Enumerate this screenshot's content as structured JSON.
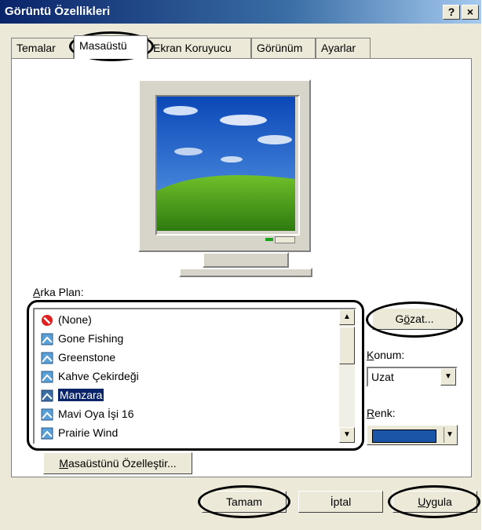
{
  "window": {
    "title": "Görüntü Özellikleri",
    "help_label": "?",
    "close_label": "×"
  },
  "tabs": [
    {
      "label": "Temalar",
      "active": false
    },
    {
      "label": "Masaüstü",
      "active": true
    },
    {
      "label": "Ekran Koruyucu",
      "active": false
    },
    {
      "label": "Görünüm",
      "active": false
    },
    {
      "label": "Ayarlar",
      "active": false
    }
  ],
  "background": {
    "label_prefix": "A",
    "label_rest": "rka Plan:",
    "items": [
      {
        "label": "(None)",
        "icon": "none-icon",
        "selected": false
      },
      {
        "label": "Gone Fishing",
        "icon": "image-file-icon",
        "selected": false
      },
      {
        "label": "Greenstone",
        "icon": "image-file-icon",
        "selected": false
      },
      {
        "label": "Kahve Çekirdeği",
        "icon": "image-file-icon",
        "selected": false
      },
      {
        "label": "Manzara",
        "icon": "image-file-icon",
        "selected": true
      },
      {
        "label": "Mavi Oya İşi 16",
        "icon": "image-file-icon",
        "selected": false
      },
      {
        "label": "Prairie Wind",
        "icon": "image-file-icon",
        "selected": false
      }
    ]
  },
  "browse": {
    "pre": "G",
    "u": "ö",
    "post": "zat..."
  },
  "position": {
    "label_u": "K",
    "label_rest": "onum:",
    "value": "Uzat"
  },
  "color": {
    "label_u": "R",
    "label_rest": "enk:",
    "value": "#1a55a8"
  },
  "customize": {
    "u": "M",
    "rest": "asaüstünü Özelleştir..."
  },
  "buttons": {
    "ok": "Tamam",
    "cancel": "İptal",
    "apply_u": "U",
    "apply_rest": "ygula"
  },
  "colors": {
    "title_bar": "#0a246a",
    "dialog_bg": "#ece9d8",
    "selection": "#0a246a"
  }
}
